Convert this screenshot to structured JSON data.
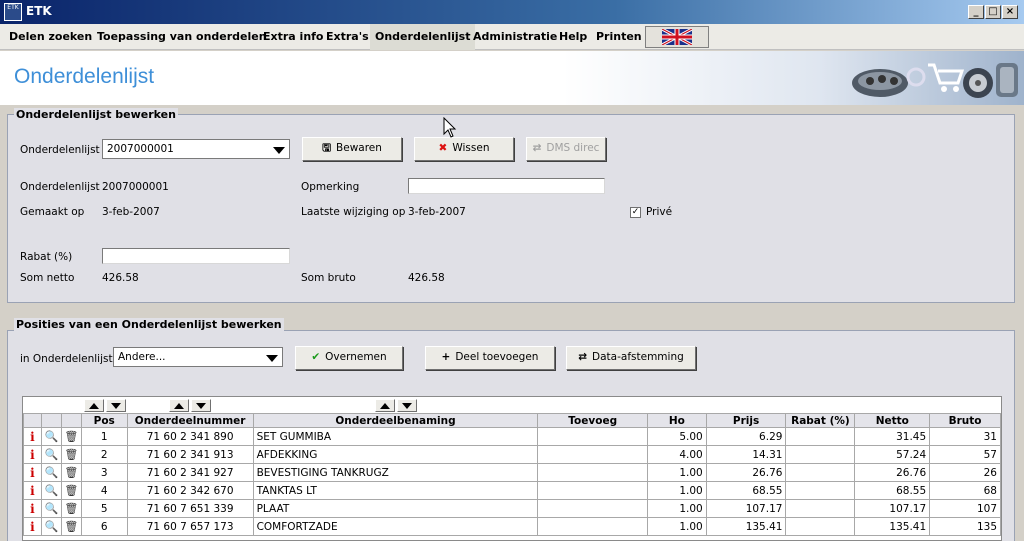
{
  "window": {
    "title": "ETK",
    "app_icon_text": "ETK"
  },
  "menu": {
    "items": [
      {
        "label": "Delen zoeken"
      },
      {
        "label": "Toepassing van onderdelen"
      },
      {
        "label": "Extra info"
      },
      {
        "label": "Extra's"
      },
      {
        "label": "Onderdelenlijst"
      },
      {
        "label": "Administratie"
      },
      {
        "label": "Help"
      },
      {
        "label": "Printen"
      }
    ],
    "active": "Onderdelenlijst",
    "flag_icon": "uk-flag-icon"
  },
  "banner": {
    "title": "Onderdelenlijst"
  },
  "edit_group": {
    "title": "Onderdelenlijst bewerken",
    "list_label": "Onderdelenlijst",
    "list_value": "2007000001",
    "save_label": "Bewaren",
    "clear_label": "Wissen",
    "dms_label": "DMS direc",
    "info_list_label": "Onderdelenlijst",
    "info_list_value": "2007000001",
    "remark_label": "Opmerking",
    "remark_value": "",
    "created_label": "Gemaakt op",
    "created_value": "3-feb-2007",
    "modified_label": "Laatste wijziging op",
    "modified_value": "3-feb-2007",
    "private_label": "Privé",
    "private_checked": true,
    "discount_label": "Rabat (%)",
    "discount_value": "",
    "net_label": "Som netto",
    "net_value": "426.58",
    "gross_label": "Som bruto",
    "gross_value": "426.58"
  },
  "positions_group": {
    "title": "Posities van een Onderdelenlijst bewerken",
    "in_list_label": "in Onderdelenlijst",
    "in_list_value": "Andere...",
    "take_over_label": "Overnemen",
    "add_part_label": "Deel toevoegen",
    "data_sync_label": "Data-afstemming"
  },
  "table": {
    "columns": [
      "Pos",
      "Onderdeelnummer",
      "Onderdeelbenaming",
      "Toevoeg",
      "Ho",
      "Prijs",
      "Rabat (%)",
      "Netto",
      "Bruto"
    ],
    "rows": [
      {
        "pos": "1",
        "nummer": "71 60 2 341 890",
        "benaming": "SET GUMMIBA",
        "toevoeg": "",
        "ho": "5.00",
        "prijs": "6.29",
        "rabat": "",
        "netto": "31.45",
        "bruto": "31"
      },
      {
        "pos": "2",
        "nummer": "71 60 2 341 913",
        "benaming": "AFDEKKING",
        "toevoeg": "",
        "ho": "4.00",
        "prijs": "14.31",
        "rabat": "",
        "netto": "57.24",
        "bruto": "57"
      },
      {
        "pos": "3",
        "nummer": "71 60 2 341 927",
        "benaming": "BEVESTIGING TANKRUGZ",
        "toevoeg": "",
        "ho": "1.00",
        "prijs": "26.76",
        "rabat": "",
        "netto": "26.76",
        "bruto": "26"
      },
      {
        "pos": "4",
        "nummer": "71 60 2 342 670",
        "benaming": "TANKTAS LT",
        "toevoeg": "",
        "ho": "1.00",
        "prijs": "68.55",
        "rabat": "",
        "netto": "68.55",
        "bruto": "68"
      },
      {
        "pos": "5",
        "nummer": "71 60 7 651 339",
        "benaming": "PLAAT",
        "toevoeg": "",
        "ho": "1.00",
        "prijs": "107.17",
        "rabat": "",
        "netto": "107.17",
        "bruto": "107"
      },
      {
        "pos": "6",
        "nummer": "71 60 7 657 173",
        "benaming": "COMFORTZADE",
        "toevoeg": "",
        "ho": "1.00",
        "prijs": "135.41",
        "rabat": "",
        "netto": "135.41",
        "bruto": "135"
      }
    ]
  },
  "colors": {
    "banner_title": "#3e8fd8",
    "titlebar": "#0a246a",
    "info_icon": "#cc0000",
    "cancel_icon": "#dd1111",
    "ok_icon": "#1a9a1a"
  }
}
